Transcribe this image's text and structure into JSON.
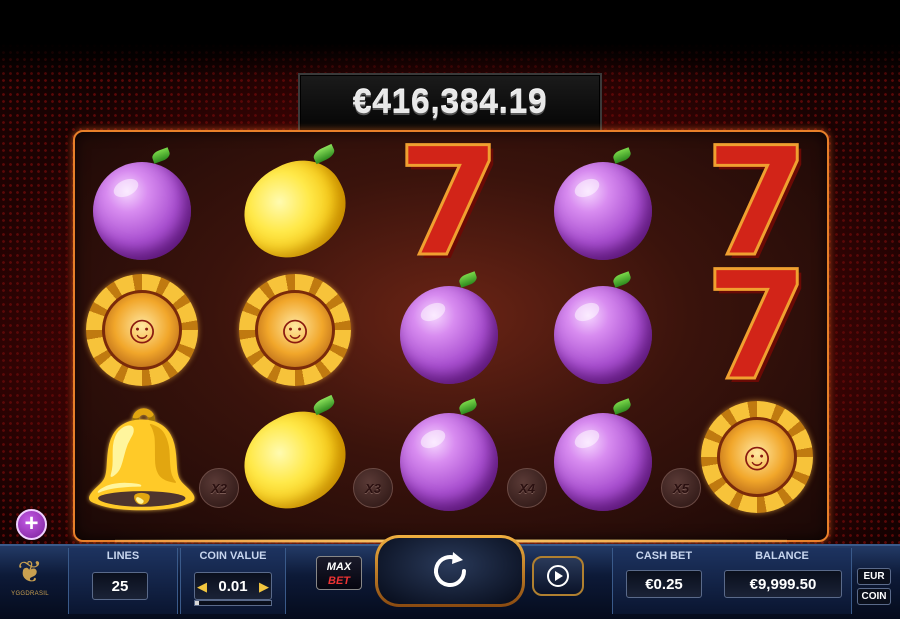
{
  "jackpot": {
    "amount": "€416,384.19"
  },
  "reels": [
    [
      "plum",
      "joker",
      "bell"
    ],
    [
      "lemon",
      "joker",
      "lemon"
    ],
    [
      "seven",
      "plum",
      "plum"
    ],
    [
      "plum",
      "plum",
      "plum"
    ],
    [
      "seven",
      "seven",
      "joker"
    ]
  ],
  "multipliers": [
    "X2",
    "X3",
    "X4",
    "X5"
  ],
  "controls": {
    "lines_label": "LINES",
    "lines_value": "25",
    "coin_value_label": "COIN VALUE",
    "coin_value": "0.01",
    "coin_value_level": 0.05,
    "max_label": "MAX",
    "bet_label": "BET",
    "cash_bet_label": "CASH BET",
    "cash_bet_value": "€0.25",
    "balance_label": "BALANCE",
    "balance_value": "€9,999.50",
    "eur_label": "EUR",
    "coin_label": "COIN"
  },
  "brand": {
    "name": "YGGDRASIL"
  },
  "colors": {
    "frame": "#e8802a",
    "plum": "#a94fd0",
    "lemon": "#ffe94a",
    "seven": "#d22418",
    "bar": "#0d1a38"
  },
  "icons": {
    "spin": "spin-arrow-icon",
    "autoplay": "play-icon",
    "plus": "plus-icon",
    "logo": "tree-icon"
  }
}
